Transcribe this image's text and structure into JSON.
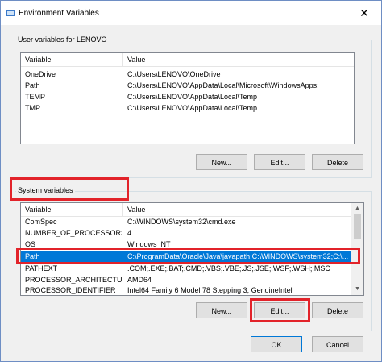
{
  "window": {
    "title": "Environment Variables",
    "close_glyph": "✕"
  },
  "user_section": {
    "label": "User variables for LENOVO",
    "headers": {
      "variable": "Variable",
      "value": "Value"
    },
    "rows": [
      {
        "variable": "OneDrive",
        "value": "C:\\Users\\LENOVO\\OneDrive"
      },
      {
        "variable": "Path",
        "value": "C:\\Users\\LENOVO\\AppData\\Local\\Microsoft\\WindowsApps;"
      },
      {
        "variable": "TEMP",
        "value": "C:\\Users\\LENOVO\\AppData\\Local\\Temp"
      },
      {
        "variable": "TMP",
        "value": "C:\\Users\\LENOVO\\AppData\\Local\\Temp"
      }
    ],
    "buttons": {
      "new": "New...",
      "edit": "Edit...",
      "delete": "Delete"
    }
  },
  "system_section": {
    "label": "System variables",
    "headers": {
      "variable": "Variable",
      "value": "Value"
    },
    "rows": [
      {
        "variable": "ComSpec",
        "value": "C:\\WINDOWS\\system32\\cmd.exe"
      },
      {
        "variable": "NUMBER_OF_PROCESSORS",
        "value": "4"
      },
      {
        "variable": "OS",
        "value": "Windows_NT"
      },
      {
        "variable": "Path",
        "value": "C:\\ProgramData\\Oracle\\Java\\javapath;C:\\WINDOWS\\system32;C:\\..."
      },
      {
        "variable": "PATHEXT",
        "value": ".COM;.EXE;.BAT;.CMD;.VBS;.VBE;.JS;.JSE;.WSF;.WSH;.MSC"
      },
      {
        "variable": "PROCESSOR_ARCHITECTURE",
        "value": "AMD64"
      },
      {
        "variable": "PROCESSOR_IDENTIFIER",
        "value": "Intel64 Family 6 Model 78 Stepping 3, GenuineIntel"
      }
    ],
    "selected_row": "Path",
    "buttons": {
      "new": "New...",
      "edit": "Edit...",
      "delete": "Delete"
    }
  },
  "dialog_buttons": {
    "ok": "OK",
    "cancel": "Cancel"
  },
  "colors": {
    "highlight": "#e2232a",
    "selection": "#0078d7"
  },
  "icons": {
    "app": "environment-app-icon",
    "close": "close-icon",
    "scroll_up": "scroll-up-arrow",
    "scroll_down": "scroll-down-arrow"
  }
}
